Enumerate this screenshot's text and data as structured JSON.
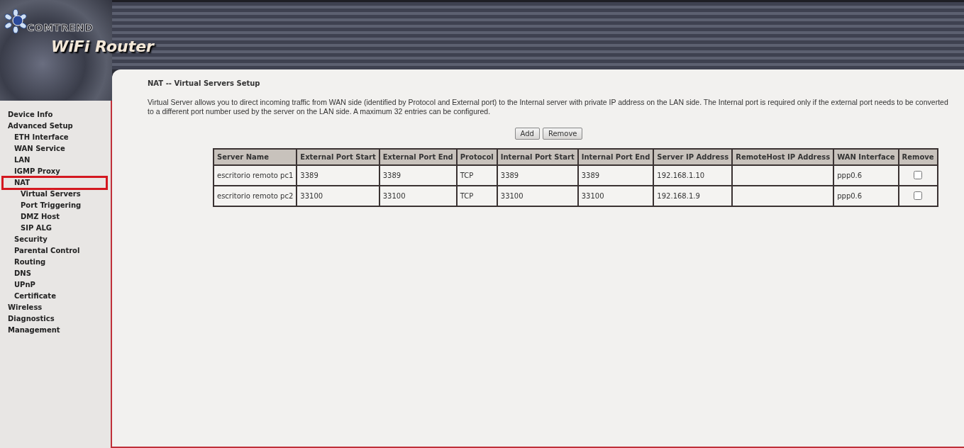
{
  "header": {
    "brand": "COMTREND",
    "product": "WiFi Router"
  },
  "sidebar": {
    "items": [
      {
        "label": "Device Info",
        "highlighted": false
      },
      {
        "label": "Advanced Setup",
        "highlighted": false,
        "children": [
          {
            "label": "ETH Interface",
            "highlighted": false
          },
          {
            "label": "WAN Service",
            "highlighted": false
          },
          {
            "label": "LAN",
            "highlighted": false
          },
          {
            "label": "IGMP Proxy",
            "highlighted": false
          },
          {
            "label": "NAT",
            "highlighted": true,
            "children": [
              {
                "label": "Virtual Servers",
                "highlighted": false
              },
              {
                "label": "Port Triggering",
                "highlighted": false
              },
              {
                "label": "DMZ Host",
                "highlighted": false
              },
              {
                "label": "SIP ALG",
                "highlighted": false
              }
            ]
          },
          {
            "label": "Security",
            "highlighted": false
          },
          {
            "label": "Parental Control",
            "highlighted": false
          },
          {
            "label": "Routing",
            "highlighted": false
          },
          {
            "label": "DNS",
            "highlighted": false
          },
          {
            "label": "UPnP",
            "highlighted": false
          },
          {
            "label": "Certificate",
            "highlighted": false
          }
        ]
      },
      {
        "label": "Wireless",
        "highlighted": false
      },
      {
        "label": "Diagnostics",
        "highlighted": false
      },
      {
        "label": "Management",
        "highlighted": false
      }
    ]
  },
  "content": {
    "title": "NAT -- Virtual Servers Setup",
    "description": "Virtual Server allows you to direct incoming traffic from WAN side (identified by Protocol and External port) to the Internal server with private IP address on the LAN side. The Internal port is required only if the external port needs to be converted to a different port number used by the server on the LAN side. A maximum 32 entries can be configured.",
    "buttons": [
      "Add",
      "Remove"
    ],
    "table": {
      "columns": [
        "Server Name",
        "External Port Start",
        "External Port End",
        "Protocol",
        "Internal Port Start",
        "Internal Port End",
        "Server IP Address",
        "RemoteHost IP Address",
        "WAN Interface",
        "Remove"
      ],
      "rows": [
        {
          "cells": [
            "escritorio remoto pc1",
            "3389",
            "3389",
            "TCP",
            "3389",
            "3389",
            "192.168.1.10",
            null,
            "ppp0.6"
          ],
          "remove_checked": false
        },
        {
          "cells": [
            "escritorio remoto pc2",
            "33100",
            "33100",
            "TCP",
            "33100",
            "33100",
            "192.168.1.9",
            null,
            "ppp0.6"
          ],
          "remove_checked": false
        }
      ]
    }
  }
}
